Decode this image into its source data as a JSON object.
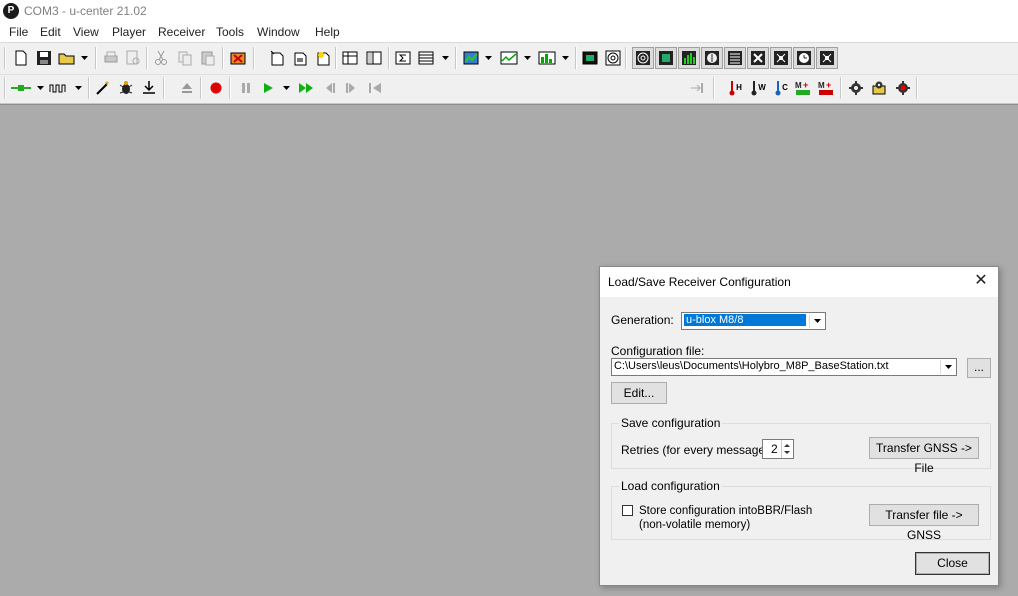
{
  "window": {
    "title": "COM3 - u-center 21.02",
    "logo_letter": "P"
  },
  "menu": [
    "File",
    "Edit",
    "View",
    "Player",
    "Receiver",
    "Tools",
    "Window",
    "Help"
  ],
  "toolbar2": {
    "msg_icons": [
      "H",
      "W",
      "C"
    ]
  },
  "playback": {
    "position": 0
  },
  "dialog": {
    "title": "Load/Save Receiver Configuration",
    "close_glyph": "✕",
    "generation_label": "Generation:",
    "generation_value": "u-blox M8/8",
    "config_file_label": "Configuration file:",
    "config_file_value": "C:\\Users\\leus\\Documents\\Holybro_M8P_BaseStation.txt",
    "browse_label": "...",
    "edit_label": "Edit...",
    "save_group_label": "Save configuration",
    "retries_label": "Retries (for every message):",
    "retries_value": "2",
    "transfer_to_file_label": "Transfer GNSS -> File",
    "load_group_label": "Load configuration",
    "store_label_line1": "Store configuration intoBBR/Flash",
    "store_label_line2": "(non-volatile memory)",
    "store_checked": false,
    "transfer_to_gnss_label": "Transfer file -> GNSS",
    "close_label": "Close"
  }
}
